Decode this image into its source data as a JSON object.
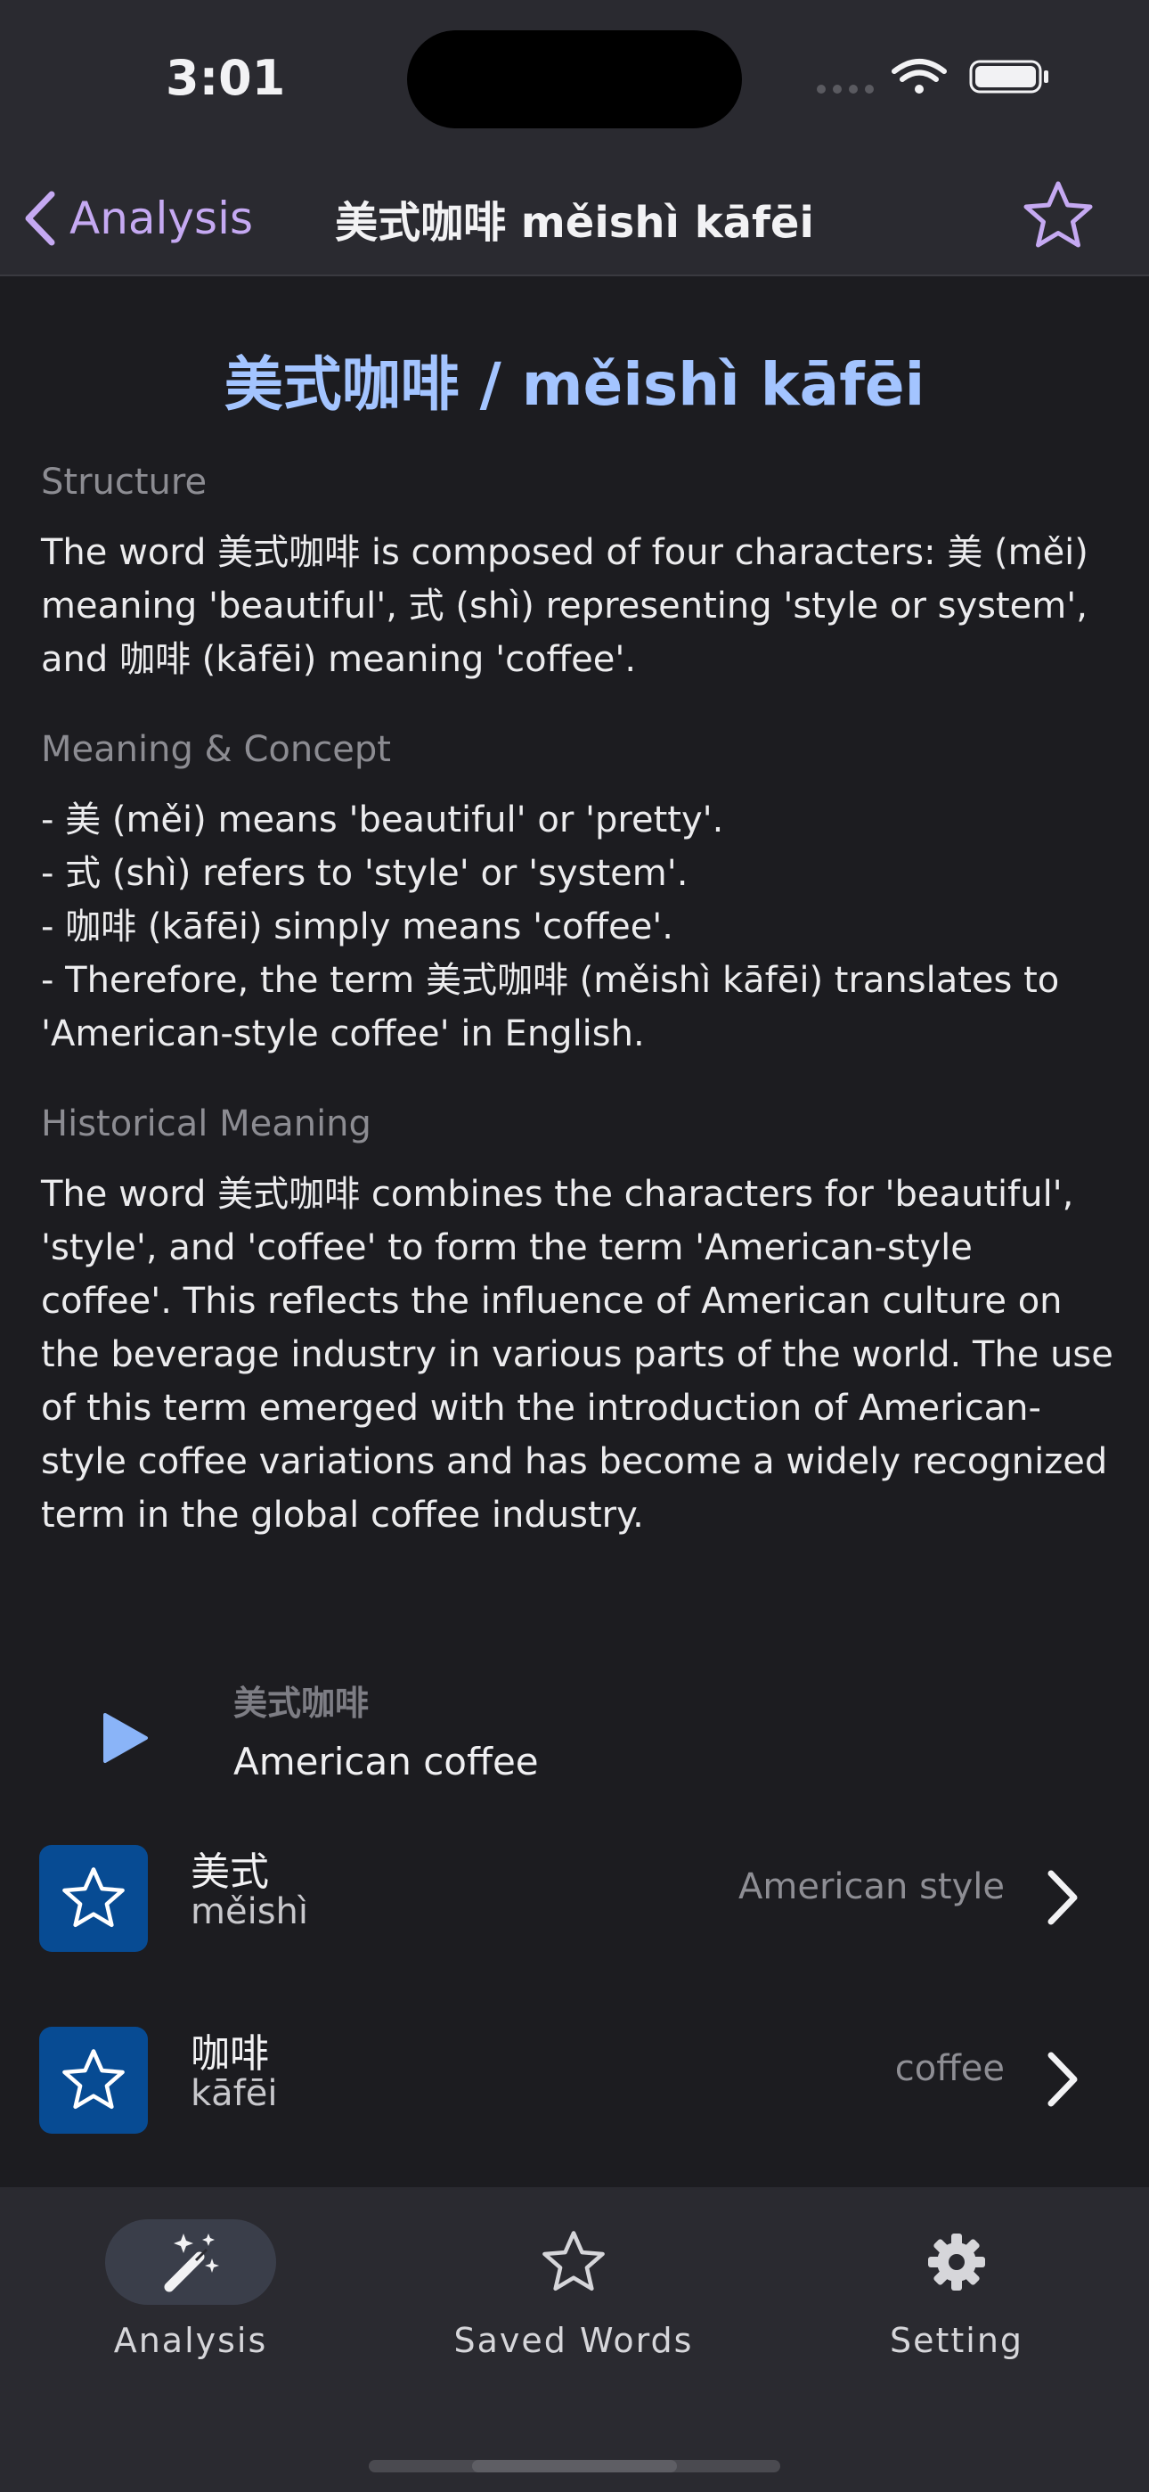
{
  "status_bar": {
    "time": "3:01"
  },
  "nav": {
    "back_label": "Analysis",
    "title": "美式咖啡 měishì kāfēi"
  },
  "headline": "美式咖啡 / měishì kāfēi",
  "sections": [
    {
      "label": "Structure",
      "body": "The word 美式咖啡 is composed of four characters: 美 (měi)\nmeaning 'beautiful', 式 (shì) representing 'style or system',\nand 咖啡 (kāfēi) meaning 'coffee'."
    },
    {
      "label": "Meaning & Concept",
      "body": "- 美 (měi) means 'beautiful' or 'pretty'.\n- 式 (shì) refers to 'style' or 'system'.\n- 咖啡 (kāfēi) simply means 'coffee'.\n- Therefore, the term 美式咖啡 (měishì kāfēi) translates to\n'American-style coffee' in English."
    },
    {
      "label": "Historical Meaning",
      "body": "The word 美式咖啡 combines the characters for 'beautiful',\n'style', and 'coffee' to form the term 'American-style\ncoffee'. This reflects the influence of American culture on\nthe beverage industry in various parts of the world. The use\nof this term emerged with the introduction of American-\nstyle coffee variations and has become a widely recognized\nterm in the global coffee industry."
    }
  ],
  "example": {
    "hanzi": "美式咖啡",
    "translation": "American coffee"
  },
  "words": [
    {
      "hanzi": "美式",
      "pinyin": "měishì",
      "meaning": "American style"
    },
    {
      "hanzi": "咖啡",
      "pinyin": "kāfēi",
      "meaning": "coffee"
    }
  ],
  "tabs": [
    {
      "label": "Analysis",
      "icon": "magic-wand-icon",
      "active": true
    },
    {
      "label": "Saved Words",
      "icon": "star-icon",
      "active": false
    },
    {
      "label": "Setting",
      "icon": "gear-icon",
      "active": false
    }
  ],
  "colors": {
    "accent_purple": "#c5a9f2",
    "headline_blue": "#a3c4ff",
    "play_blue": "#8ab4f8",
    "star_box": "#074b93"
  }
}
